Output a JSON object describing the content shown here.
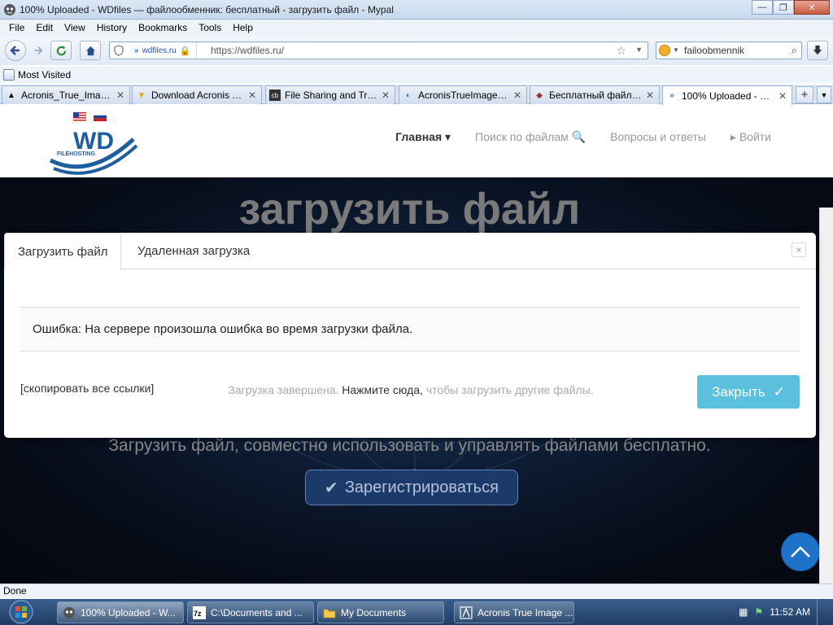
{
  "window": {
    "title": "100% Uploaded - WDfiles — файлообменник: бесплатный - загрузить файл - Mypal",
    "minimize": "—",
    "maximize": "❐",
    "close": "✕"
  },
  "menu": [
    "File",
    "Edit",
    "View",
    "History",
    "Bookmarks",
    "Tools",
    "Help"
  ],
  "nav": {
    "site_identity": "wdfiles.ru",
    "url": "https://wdfiles.ru/",
    "search_text": "failoobmennik"
  },
  "bookmarks": {
    "most_visited": "Most Visited"
  },
  "tabs": [
    {
      "label": "Acronis_True_Image_...",
      "icon": "acronis-icon"
    },
    {
      "label": "Download Acronis Tr...",
      "icon": "download-icon"
    },
    {
      "label": "File Sharing and Tran...",
      "icon": "wdfiles-icon"
    },
    {
      "label": "AcronisTrueImage202...",
      "icon": "acronis-icon"
    },
    {
      "label": "Бесплатный файлоо...",
      "icon": "files-icon"
    },
    {
      "label": "100% Uploaded - W...",
      "icon": "wdfiles-icon",
      "active": true
    }
  ],
  "site": {
    "logo_text": "WD",
    "logo_sub": "FILEHOSTING",
    "nav_links": [
      "Главная ▾",
      "Поиск по файлам 🔍",
      "Вопросы и ответы",
      "▸ Войти"
    ],
    "hero_title": "загрузить файл",
    "hero_subtitle": "Загрузить файл, совместно использовать и управлять файлами бесплатно.",
    "register_label": "Зарегистрироваться"
  },
  "modal": {
    "tab_upload": "Загрузить файл",
    "tab_remote": "Удаленная загрузка",
    "close_x": "×",
    "error_message": "Ошибка: На сервере произошла ошибка во время загрузки файла.",
    "copy_links": "[скопировать все ссылки]",
    "status_prefix": "Загрузка завершена.",
    "status_click": "Нажмите сюда,",
    "status_suffix": "чтобы загрузить другие файлы.",
    "close_button": "Закрыть"
  },
  "statusbar": {
    "text": "Done"
  },
  "taskbar": {
    "items": [
      {
        "label": "100% Uploaded - W...",
        "active": true
      },
      {
        "label": "C:\\Documents and ..."
      },
      {
        "label": "My Documents"
      },
      {
        "label": "Acronis True Image ..."
      }
    ],
    "clock": "11:52 AM"
  },
  "colors": {
    "accent": "#5bc0de",
    "scroll_top": "#1e73c9",
    "logo_blue": "#1f5f9e"
  }
}
